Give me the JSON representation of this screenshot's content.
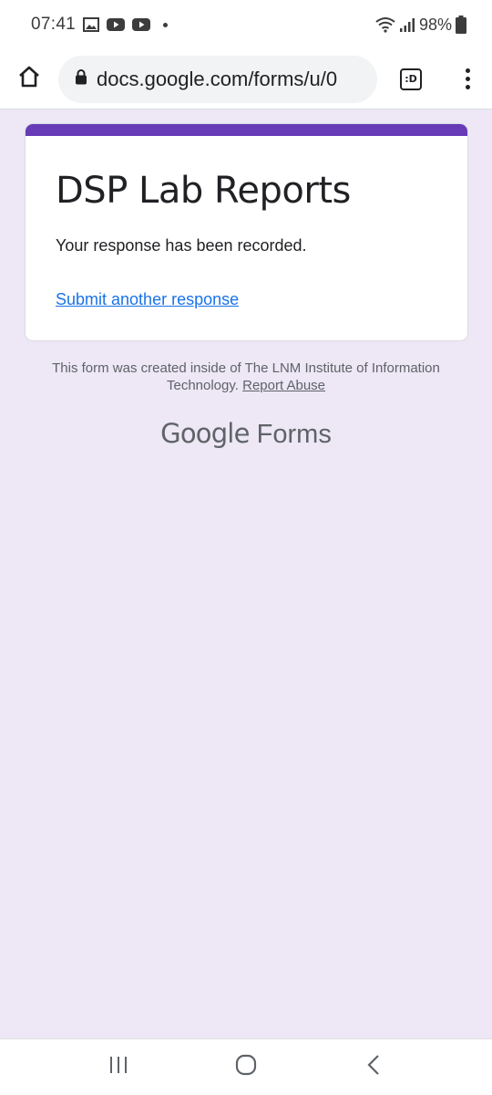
{
  "status_bar": {
    "time": "07:41",
    "battery": "98%",
    "notification_icons": [
      "gallery-icon",
      "youtube-icon",
      "youtube-icon"
    ]
  },
  "browser": {
    "url": "docs.google.com/forms/u/0",
    "tab_badge": ":D"
  },
  "form": {
    "title": "DSP Lab Reports",
    "confirmation": "Your response has been recorded.",
    "submit_another": "Submit another response",
    "accent_color": "#673ab7"
  },
  "footer": {
    "created_text": "This form was created inside of The LNM Institute of Information Technology.",
    "report_abuse": "Report Abuse",
    "brand_google": "Google",
    "brand_forms": "Forms"
  },
  "colors": {
    "page_background": "#ede7f6",
    "link": "#1a73e8"
  }
}
